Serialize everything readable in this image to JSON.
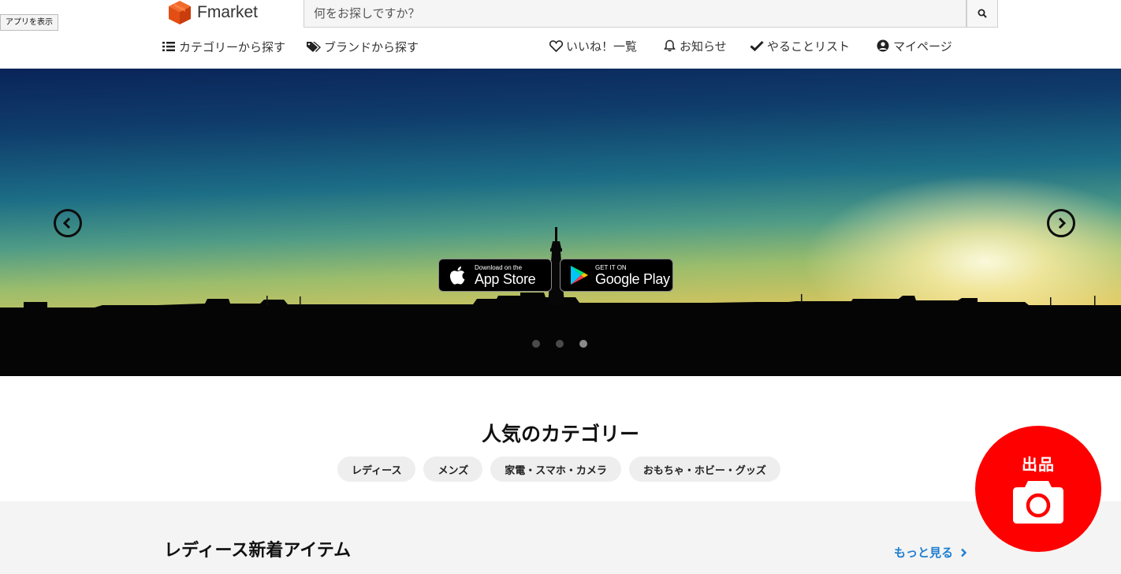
{
  "app_tooltip": "アプリを表示",
  "header": {
    "logo_text": "Fmarket",
    "search": {
      "placeholder": "何をお探しですか？",
      "value": ""
    },
    "nav_left": [
      {
        "label": "カテゴリーから探す",
        "icon": "list-icon"
      },
      {
        "label": "ブランドから探す",
        "icon": "tags-icon"
      }
    ],
    "nav_right": [
      {
        "label": "いいね！一覧",
        "icon": "heart-icon"
      },
      {
        "label": "お知らせ",
        "icon": "bell-icon"
      },
      {
        "label": "やることリスト",
        "icon": "check-icon"
      },
      {
        "label": "マイページ",
        "icon": "user-circle-icon"
      }
    ]
  },
  "hero": {
    "app_store": {
      "small": "Download on the",
      "big": "App Store"
    },
    "google_play": {
      "small": "GET IT ON",
      "big": "Google Play"
    },
    "slide_count": 3,
    "active_slide": 3
  },
  "popular_categories": {
    "title": "人気のカテゴリー",
    "chips": [
      "レディース",
      "メンズ",
      "家電・スマホ・カメラ",
      "おもちゃ・ホビー・グッズ"
    ]
  },
  "new_items": {
    "title": "レディース新着アイテム",
    "see_more": "もっと見る"
  },
  "sell_button": {
    "label": "出品",
    "icon": "camera-icon",
    "color": "#ff0000"
  },
  "colors": {
    "brand": "#e8531f",
    "link": "#1e7fd0"
  }
}
